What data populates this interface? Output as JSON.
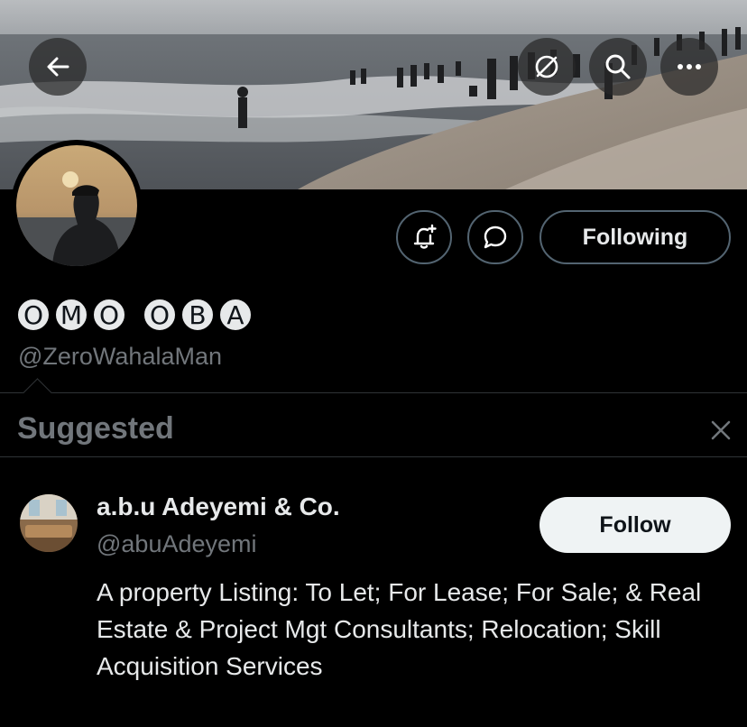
{
  "header": {
    "back_icon": "arrow-left-icon",
    "grok_icon": "grok-icon",
    "search_icon": "search-icon",
    "more_icon": "more-dots-icon"
  },
  "profile": {
    "name_letters_group1": [
      "O",
      "M",
      "O"
    ],
    "name_letters_group2": [
      "O",
      "B",
      "A"
    ],
    "handle": "@ZeroWahalaMan",
    "notify_icon": "bell-plus-icon",
    "message_icon": "message-bubble-icon",
    "following_label": "Following"
  },
  "suggested": {
    "title": "Suggested",
    "close_icon": "close-icon",
    "account": {
      "name": "a.b.u Adeyemi & Co.",
      "handle": "@abuAdeyemi",
      "follow_label": "Follow",
      "bio": "A property Listing: To Let; For Lease; For Sale; & Real Estate & Project Mgt Consultants; Relocation; Skill Acquisition Services"
    }
  },
  "colors": {
    "background": "#000000",
    "text_primary": "#e7e9ea",
    "text_secondary": "#71767b",
    "border": "#2f3336",
    "follow_button_bg": "#eff3f4"
  }
}
